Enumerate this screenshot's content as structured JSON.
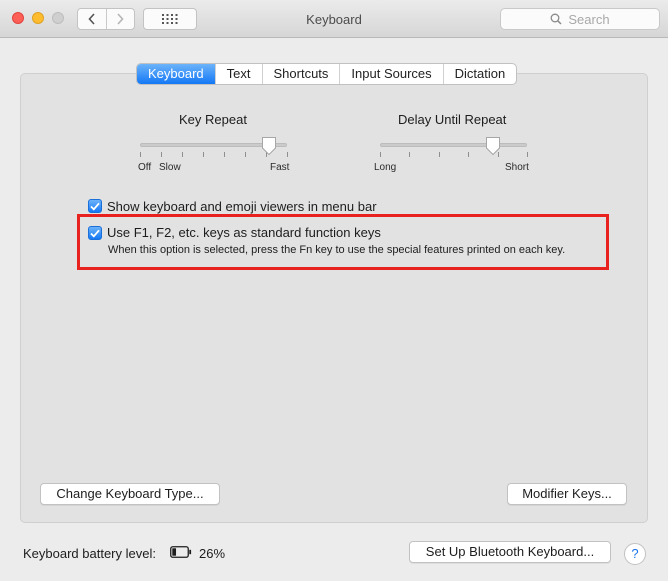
{
  "window": {
    "title": "Keyboard",
    "search_placeholder": "Search"
  },
  "tabs": [
    {
      "label": "Keyboard",
      "active": true
    },
    {
      "label": "Text",
      "active": false
    },
    {
      "label": "Shortcuts",
      "active": false
    },
    {
      "label": "Input Sources",
      "active": false
    },
    {
      "label": "Dictation",
      "active": false
    }
  ],
  "key_repeat": {
    "title": "Key Repeat",
    "label_off": "Off",
    "label_slow": "Slow",
    "label_fast": "Fast",
    "value_fraction": 0.875
  },
  "delay_until_repeat": {
    "title": "Delay Until Repeat",
    "label_long": "Long",
    "label_short": "Short",
    "value_fraction": 0.77
  },
  "options": {
    "show_viewers": {
      "label": "Show keyboard and emoji viewers in menu bar",
      "checked": true
    },
    "function_keys": {
      "label": "Use F1, F2, etc. keys as standard function keys",
      "note": "When this option is selected, press the Fn key to use the special features printed on each key.",
      "checked": true
    }
  },
  "buttons": {
    "change_type": "Change Keyboard Type...",
    "modifier_keys": "Modifier Keys...",
    "bluetooth": "Set Up Bluetooth Keyboard..."
  },
  "battery": {
    "label": "Keyboard battery level:",
    "percent": "26%",
    "level_fraction": 0.26
  },
  "help": "?",
  "colors": {
    "accent": "#1478f5",
    "highlight_border": "#e8231f"
  }
}
